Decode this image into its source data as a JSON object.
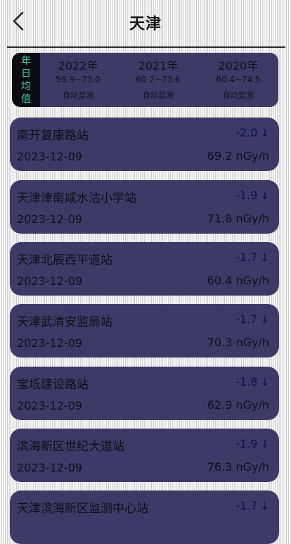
{
  "header": {
    "title": "天津",
    "back_icon": "chevron-left-icon"
  },
  "annual": {
    "label": "年日均值",
    "years": [
      {
        "year": "2022年",
        "range": "59.9~73.0",
        "method": "自动监测"
      },
      {
        "year": "2021年",
        "range": "60.2~73.6",
        "method": "自动监测"
      },
      {
        "year": "2020年",
        "range": "60.4~74.5",
        "method": "自动监测"
      }
    ]
  },
  "stations": [
    {
      "name": "南开复康路站",
      "delta": "-2.0",
      "trend_icon": "arrow-down-icon",
      "date": "2023-12-09",
      "value": "69.2 nGy/h"
    },
    {
      "name": "天津津南咸水沽小学站",
      "delta": "-1.9",
      "trend_icon": "arrow-down-icon",
      "date": "2023-12-09",
      "value": "71.8 nGy/h"
    },
    {
      "name": "天津北辰西平道站",
      "delta": "-1.7",
      "trend_icon": "arrow-down-icon",
      "date": "2023-12-09",
      "value": "60.4 nGy/h"
    },
    {
      "name": "天津武清安监局站",
      "delta": "-1.7",
      "trend_icon": "arrow-down-icon",
      "date": "2023-12-09",
      "value": "70.3 nGy/h"
    },
    {
      "name": "宝坻建设路站",
      "delta": "-1.8",
      "trend_icon": "arrow-down-icon",
      "date": "2023-12-09",
      "value": "62.9 nGy/h"
    },
    {
      "name": "滨海新区世纪大道站",
      "delta": "-1.9",
      "trend_icon": "arrow-down-icon",
      "date": "2023-12-09",
      "value": "76.3 nGy/h"
    },
    {
      "name": "天津滨海新区监测中心站",
      "delta": "-1.7",
      "trend_icon": "arrow-down-icon",
      "date": "",
      "value": ""
    }
  ],
  "colors": {
    "card": "#3c3a66",
    "label_bg": "#0a0a12",
    "label_text": "#2fd6a7",
    "delta": "#10105a"
  }
}
